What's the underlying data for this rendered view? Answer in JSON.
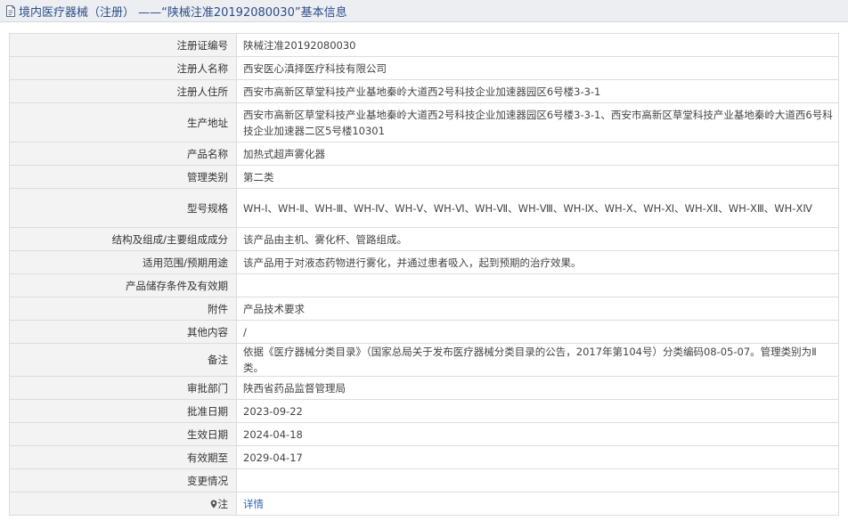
{
  "header": {
    "title": "境内医疗器械（注册） ——“陕械注准20192080030”基本信息",
    "icon": "document-icon"
  },
  "rows": [
    {
      "label": "注册证编号",
      "value": "陕械注准20192080030"
    },
    {
      "label": "注册人名称",
      "value": "西安医心滇择医疗科技有限公司"
    },
    {
      "label": "注册人住所",
      "value": "西安市高新区草堂科技产业基地秦岭大道西2号科技企业加速器园区6号楼3-3-1"
    },
    {
      "label": "生产地址",
      "value": "西安市高新区草堂科技产业基地秦岭大道西2号科技企业加速器园区6号楼3-3-1、西安市高新区草堂科技产业基地秦岭大道西6号科技企业加速器二区5号楼10301"
    },
    {
      "label": "产品名称",
      "value": "加热式超声雾化器"
    },
    {
      "label": "管理类别",
      "value": "第二类"
    },
    {
      "label": "型号规格",
      "value": "WH-Ⅰ、WH-Ⅱ、WH-Ⅲ、WH-Ⅳ、WH-Ⅴ、WH-Ⅵ、WH-Ⅶ、WH-Ⅷ、WH-Ⅸ、WH-Ⅹ、WH-Ⅺ、WH-ⅩⅡ、WH-ⅩⅢ、WH-ⅩⅣ"
    },
    {
      "label": "结构及组成/主要组成成分",
      "value": "该产品由主机、雾化杯、管路组成。"
    },
    {
      "label": "适用范围/预期用途",
      "value": "该产品用于对液态药物进行雾化，并通过患者吸入，起到预期的治疗效果。"
    },
    {
      "label": "产品储存条件及有效期",
      "value": ""
    },
    {
      "label": "附件",
      "value": "产品技术要求"
    },
    {
      "label": "其他内容",
      "value": "/"
    },
    {
      "label": "备注",
      "value": "依据《医疗器械分类目录》（国家总局关于发布医疗器械分类目录的公告，2017年第104号）分类编码08-05-07。管理类别为Ⅱ类。"
    },
    {
      "label": "审批部门",
      "value": "陕西省药品监督管理局"
    },
    {
      "label": "批准日期",
      "value": "2023-09-22"
    },
    {
      "label": "生效日期",
      "value": "2024-04-18"
    },
    {
      "label": "有效期至",
      "value": "2029-04-17"
    },
    {
      "label": "变更情况",
      "value": ""
    }
  ],
  "note": {
    "label": "注",
    "link": "详情",
    "icon": "pin-icon"
  },
  "colors": {
    "title": "#2b4d8c",
    "link": "#2d64b3",
    "label_bg": "#f3f3f3",
    "border": "#dcdcdc",
    "title_bg": "#eceef1"
  }
}
